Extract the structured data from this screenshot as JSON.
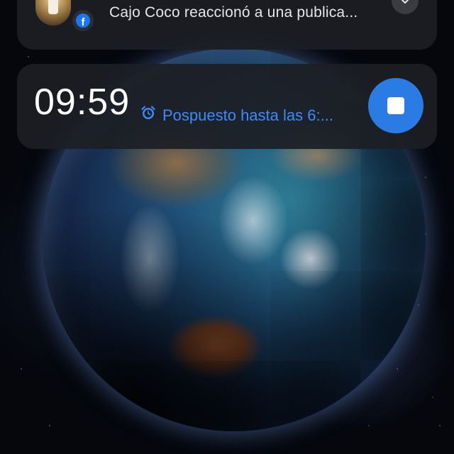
{
  "notifications": {
    "facebook": {
      "app_icon": "facebook-icon",
      "message": "Cajo Coco reaccionó a una publica...",
      "expand_icon": "chevron-down-icon"
    },
    "alarm": {
      "time": "09:59",
      "status_icon": "alarm-clock-icon",
      "status_text": "Pospuesto hasta las 6:...",
      "stop_icon": "stop-icon"
    }
  },
  "colors": {
    "card_bg": "#1c1e24",
    "accent_blue": "#2b7be4",
    "status_blue": "#3d8bff",
    "facebook_blue": "#1877f2"
  }
}
